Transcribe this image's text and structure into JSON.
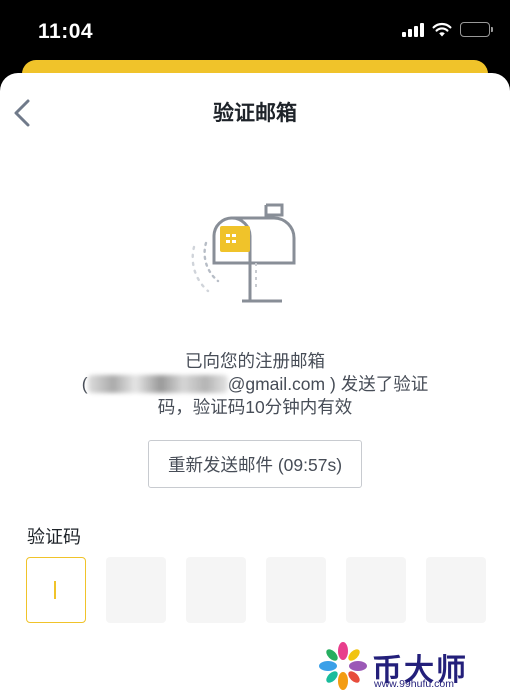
{
  "status_bar": {
    "time": "11:04"
  },
  "header": {
    "title": "验证邮箱"
  },
  "info": {
    "line1": "已向您的注册邮箱",
    "line2_open": "(",
    "line2_email": "@gmail.com",
    "line2_rest": ") 发送了验证",
    "line3": "码，验证码10分钟内有效"
  },
  "resend": {
    "label": "重新发送邮件 (09:57s)"
  },
  "code": {
    "label": "验证码",
    "length": 6
  },
  "watermark": {
    "text": "币大师",
    "url": "www.99hufu.com"
  },
  "colors": {
    "accent": "#f0c32a",
    "text": "#1e2329",
    "secondary": "#474d57",
    "box": "#f5f5f5"
  }
}
